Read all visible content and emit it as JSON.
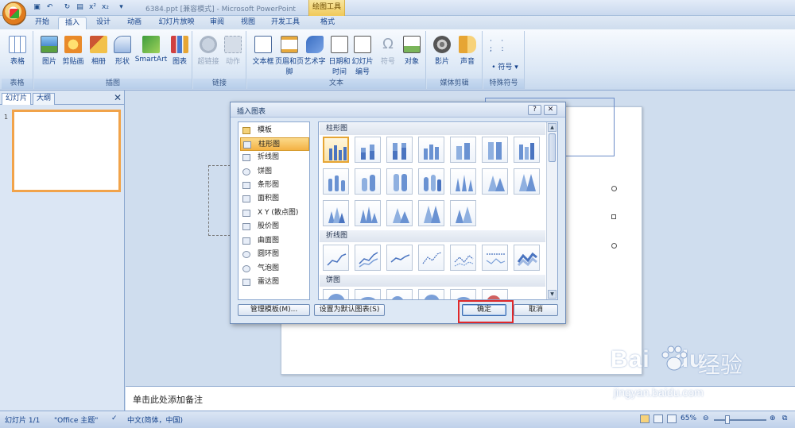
{
  "app": {
    "doc_title": "6384.ppt [兼容模式] - Microsoft PowerPoint",
    "context_tab_group": "绘图工具"
  },
  "tabs": [
    {
      "label": "开始"
    },
    {
      "label": "插入",
      "active": true
    },
    {
      "label": "设计"
    },
    {
      "label": "动画"
    },
    {
      "label": "幻灯片放映"
    },
    {
      "label": "审阅"
    },
    {
      "label": "视图"
    },
    {
      "label": "开发工具"
    },
    {
      "label": "格式"
    }
  ],
  "ribbon": {
    "groups": [
      {
        "label": "表格",
        "buttons": [
          "表格"
        ]
      },
      {
        "label": "插图",
        "buttons": [
          "图片",
          "剪贴画",
          "相册",
          "形状",
          "SmartArt",
          "图表"
        ]
      },
      {
        "label": "链接",
        "buttons": [
          "超链接",
          "动作"
        ]
      },
      {
        "label": "文本",
        "buttons": [
          "文本框",
          "页眉和页脚",
          "艺术字",
          "日期和时间",
          "幻灯片编号",
          "符号",
          "对象"
        ]
      },
      {
        "label": "媒体剪辑",
        "buttons": [
          "影片",
          "声音"
        ]
      },
      {
        "label": "特殊符号",
        "buttons": [
          "符号"
        ]
      }
    ]
  },
  "left_pane": {
    "tabs": [
      "幻灯片",
      "大纲"
    ],
    "close_glyph": "✕",
    "slide_number": "1"
  },
  "notes": {
    "placeholder": "单击此处添加备注"
  },
  "status_bar": {
    "slide_info": "幻灯片 1/1",
    "theme": "\"Office 主题\"",
    "language": "中文(简体，中国)",
    "zoom": "65%"
  },
  "dialog": {
    "title": "插入图表",
    "help_glyph": "?",
    "close_glyph": "✕",
    "categories": [
      {
        "label": "模板"
      },
      {
        "label": "柱形图",
        "selected": true
      },
      {
        "label": "折线图"
      },
      {
        "label": "饼图"
      },
      {
        "label": "条形图"
      },
      {
        "label": "面积图"
      },
      {
        "label": "X Y (散点图)"
      },
      {
        "label": "股价图"
      },
      {
        "label": "曲面图"
      },
      {
        "label": "圆环图"
      },
      {
        "label": "气泡图"
      },
      {
        "label": "雷达图"
      }
    ],
    "sections": [
      "柱形图",
      "折线图",
      "饼图"
    ],
    "buttons": {
      "manage": "管理模板(M)...",
      "set_default": "设置为默认图表(S)",
      "ok": "确定",
      "cancel": "取消"
    }
  },
  "watermark": {
    "brand": "Bai",
    "brand2": "du",
    "product": "经验",
    "url": "jingyan.baidu.com"
  }
}
